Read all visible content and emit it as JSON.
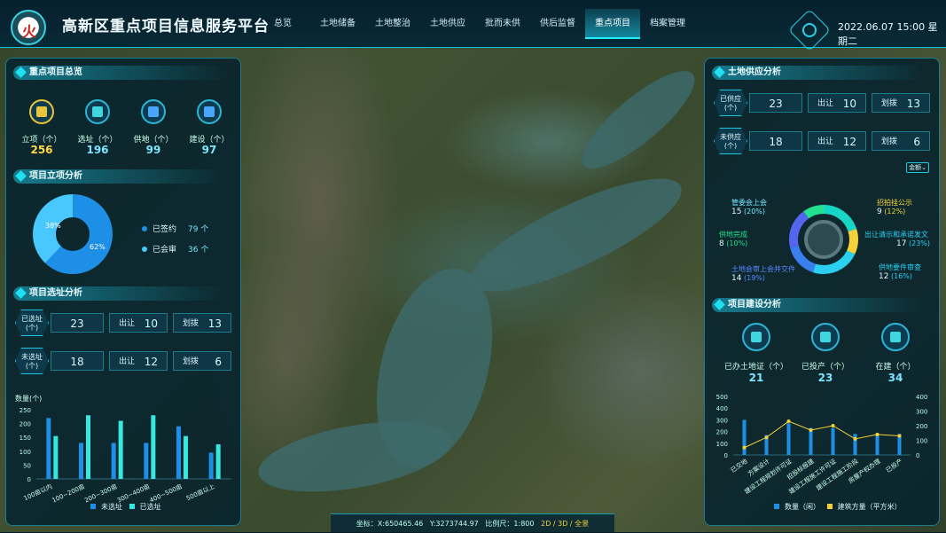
{
  "header": {
    "title": "高新区重点项目信息服务平台",
    "nav": [
      "总览",
      "土地储备",
      "土地整治",
      "土地供应",
      "批而未供",
      "供后监督",
      "重点项目",
      "档案管理"
    ],
    "active": "重点项目",
    "datetime": "2022.06.07  15:00  星期二",
    "logo_mark": "火"
  },
  "left": {
    "overview": {
      "title": "重点项目总览",
      "items": [
        {
          "label": "立项（个）",
          "value": "256",
          "color": "#ffd84a"
        },
        {
          "label": "选址（个）",
          "value": "196",
          "color": "#7be6ff"
        },
        {
          "label": "供地（个）",
          "value": "99",
          "color": "#7be6ff"
        },
        {
          "label": "建设（个）",
          "value": "97",
          "color": "#7be6ff"
        }
      ]
    },
    "project": {
      "title": "项目立项分析",
      "pie": [
        {
          "label": "已签约",
          "value": "79",
          "pct": "62%",
          "unit": "个",
          "color": "#1e8fe6"
        },
        {
          "label": "已会审",
          "value": "36",
          "pct": "38%",
          "unit": "个",
          "color": "#49c8ff"
        }
      ]
    },
    "site": {
      "title": "项目选址分析",
      "rows": [
        {
          "head": "已选址\n(个)",
          "total": "23",
          "a_label": "出让",
          "a": "10",
          "b_label": "划拨",
          "b": "13"
        },
        {
          "head": "未选址\n(个)",
          "total": "18",
          "a_label": "出让",
          "a": "12",
          "b_label": "划拨",
          "b": "6"
        }
      ]
    },
    "bar": {
      "unit": "数量(个)",
      "ticks": [
        "250",
        "200",
        "150",
        "100",
        "50",
        "0"
      ]
    },
    "legend": [
      "未选址",
      "已选址"
    ]
  },
  "right": {
    "supply": {
      "title": "土地供应分析",
      "rows": [
        {
          "head": "已供应\n(个)",
          "total": "23",
          "a_label": "出让",
          "a": "10",
          "b_label": "划拨",
          "b": "13"
        },
        {
          "head": "未供应\n(个)",
          "total": "18",
          "a_label": "出让",
          "a": "12",
          "b_label": "划拨",
          "b": "6"
        }
      ],
      "dropdown": "金额"
    },
    "ring": [
      {
        "label": "管委会上会",
        "value": "15",
        "pct": "(20%)"
      },
      {
        "label": "招拍挂公示",
        "value": "9",
        "pct": "(12%)"
      },
      {
        "label": "供地完成",
        "value": "8",
        "pct": "(10%)"
      },
      {
        "label": "出让请示和承诺发文",
        "value": "17",
        "pct": "(23%)"
      },
      {
        "label": "土地会审上会并交件",
        "value": "14",
        "pct": "(19%)"
      },
      {
        "label": "供地要件审查",
        "value": "12",
        "pct": "(16%)"
      }
    ],
    "build": {
      "title": "项目建设分析",
      "items": [
        {
          "label": "已办土地证（个）",
          "value": "21"
        },
        {
          "label": "已投产（个）",
          "value": "23"
        },
        {
          "label": "在建（个）",
          "value": "34"
        }
      ]
    },
    "chart_ticks_left": [
      "500",
      "400",
      "300",
      "200",
      "100",
      "0"
    ],
    "chart_ticks_right": [
      "400",
      "300",
      "200",
      "100",
      "0"
    ],
    "legend": [
      "数量（闲）",
      "建筑方量（平方米）"
    ]
  },
  "chart_data": [
    {
      "type": "bar",
      "title": "",
      "ylabel": "数量(个)",
      "ylim": [
        0,
        250
      ],
      "categories": [
        "100亩以内",
        "100~200亩",
        "200~300亩",
        "300~400亩",
        "400~500亩",
        "500亩以上"
      ],
      "series": [
        {
          "name": "未选址",
          "values": [
            220,
            130,
            130,
            130,
            190,
            95
          ]
        },
        {
          "name": "已选址",
          "values": [
            155,
            230,
            210,
            230,
            155,
            125
          ]
        }
      ]
    },
    {
      "type": "bar",
      "title": "",
      "ylim": [
        0,
        500
      ],
      "categories": [
        "已交地",
        "方案设计",
        "建设工程规划许可证",
        "招投标报建",
        "建设工程施工许可证",
        "建设工程施工阶段",
        "房屋产权办理",
        "已投产"
      ],
      "series": [
        {
          "name": "数量（闲）",
          "values": [
            300,
            170,
            270,
            230,
            230,
            180,
            170,
            180
          ]
        },
        {
          "name": "建筑方量（平方米）",
          "values": [
            50,
            120,
            230,
            170,
            200,
            110,
            140,
            130
          ]
        }
      ]
    }
  ],
  "bottom": {
    "coord_label": "坐标：",
    "x": "X:650465.46",
    "y": "Y:3273744.97",
    "scale": "比例尺：1:800",
    "mode": "2D / 3D / 全景"
  }
}
